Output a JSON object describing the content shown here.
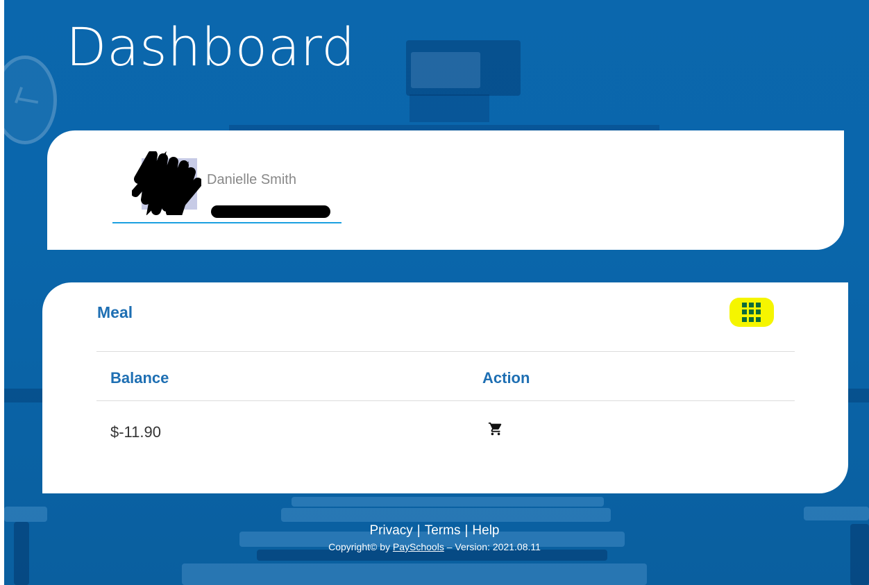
{
  "page": {
    "title": "Dashboard"
  },
  "profile": {
    "student_name": "Danielle Smith"
  },
  "meal": {
    "title": "Meal",
    "columns": {
      "balance": "Balance",
      "action": "Action"
    },
    "balance_value": "$-11.90"
  },
  "footer": {
    "privacy": "Privacy",
    "terms": "Terms",
    "help": "Help",
    "separator": "|",
    "copyright_prefix": "Copyright© by",
    "brand": "PaySchools",
    "version_text": "– Version: 2021.08.11"
  },
  "icons": {
    "grid": "grid-icon",
    "cart": "cart-icon"
  },
  "colors": {
    "background": "#0a66ab",
    "accent_blue": "#1e6fb3",
    "highlight_yellow": "#f5f500",
    "underline_blue": "#1aa0e0"
  }
}
